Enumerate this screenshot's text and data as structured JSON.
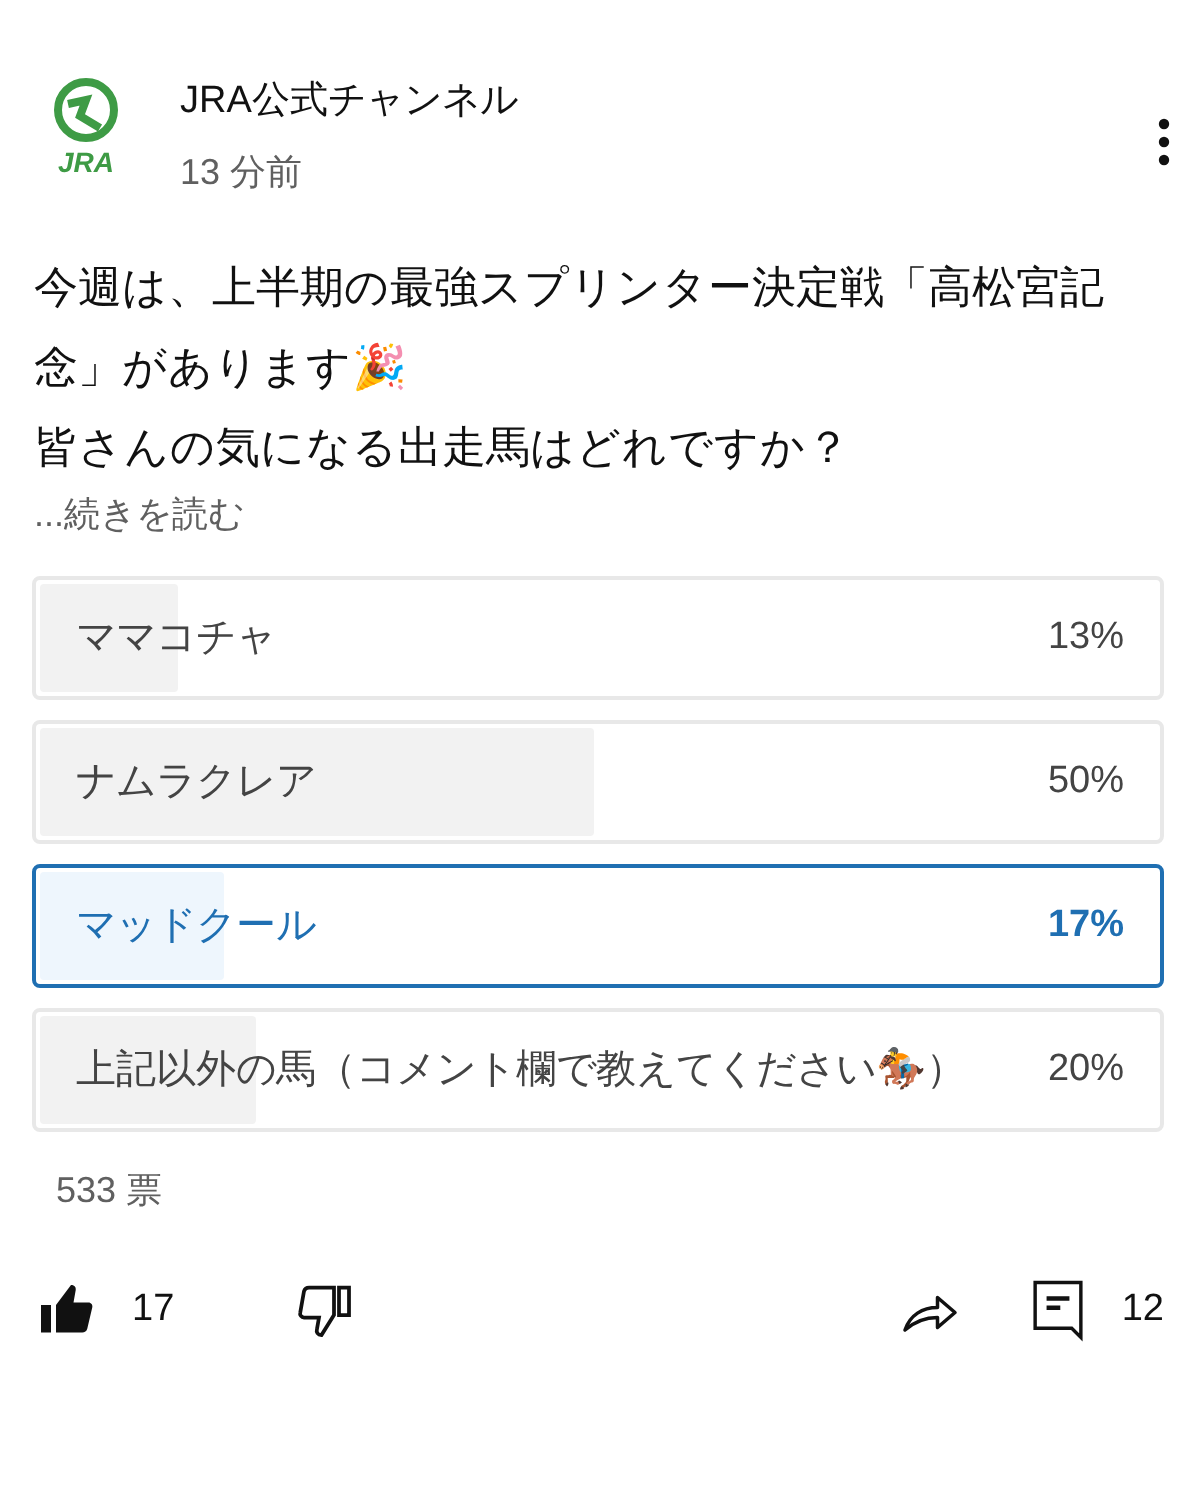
{
  "channel": {
    "name": "JRA公式チャンネル",
    "logo_text": "JRA",
    "time": "13 分前"
  },
  "post": {
    "lines": [
      "今週は、上半期の最強スプリンター決定戦「高松宮記念」があります🎉",
      "皆さんの気になる出走馬はどれですか？"
    ],
    "more": "...続きを読む"
  },
  "poll": {
    "options": [
      {
        "label": "ママコチャ",
        "percent": "13%",
        "level": 0.13,
        "selected": false
      },
      {
        "label": "ナムラクレア",
        "percent": "50%",
        "level": 0.5,
        "selected": false
      },
      {
        "label": "マッドクール",
        "percent": "17%",
        "level": 0.17,
        "selected": true
      },
      {
        "label": "上記以外の馬（コメント欄で教えてください🏇）",
        "percent": "20%",
        "level": 0.2,
        "selected": false
      }
    ],
    "votes": "533 票"
  },
  "actions": {
    "liked": true,
    "likes": "17",
    "comments": "12"
  }
}
